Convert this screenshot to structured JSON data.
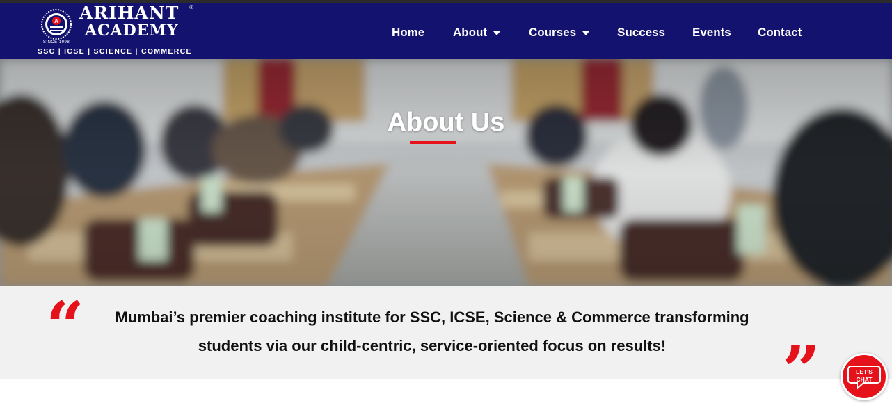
{
  "header": {
    "logo": {
      "name_line1": "ARIHANT",
      "name_line2": "ACADEMY",
      "registered_mark": "®",
      "since": "SINCE 1998",
      "tagline": "SSC | ICSE | SCIENCE | COMMERCE",
      "emblem_letter": "A"
    },
    "nav": {
      "home": "Home",
      "about": "About",
      "courses": "Courses",
      "success": "Success",
      "events": "Events",
      "contact": "Contact"
    }
  },
  "hero": {
    "title": "About Us"
  },
  "quote": {
    "open_mark": "“",
    "close_mark": "”",
    "line1": "Mumbai’s premier coaching institute for SSC, ICSE, Science & Commerce transforming",
    "line2": "students via our child-centric, service-oriented focus on results!"
  },
  "chat_widget": {
    "line1": "LET'S",
    "line2": "CHAT"
  },
  "colors": {
    "header_bg": "#13126e",
    "accent_red": "#e5121b",
    "quote_band_bg": "#f1f1f1"
  }
}
